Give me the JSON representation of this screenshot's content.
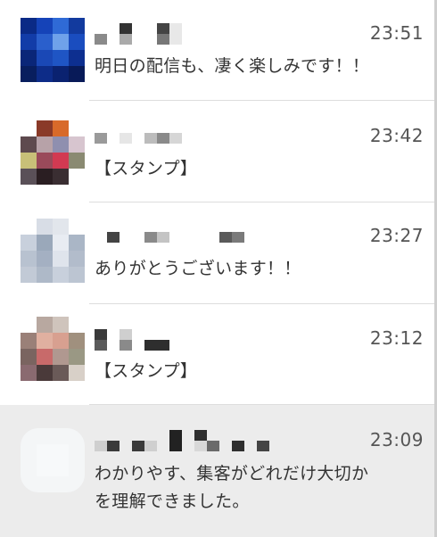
{
  "chats": [
    {
      "time": "23:51",
      "preview": "明日の配信も、凄く楽しみです！！"
    },
    {
      "time": "23:42",
      "preview": "【スタンプ】"
    },
    {
      "time": "23:27",
      "preview": "ありがとうございます！！"
    },
    {
      "time": "23:12",
      "preview": "【スタンプ】"
    },
    {
      "time": "23:09",
      "preview": "わかりやす、集客がどれだけ大切か\nを理解できました。"
    }
  ]
}
